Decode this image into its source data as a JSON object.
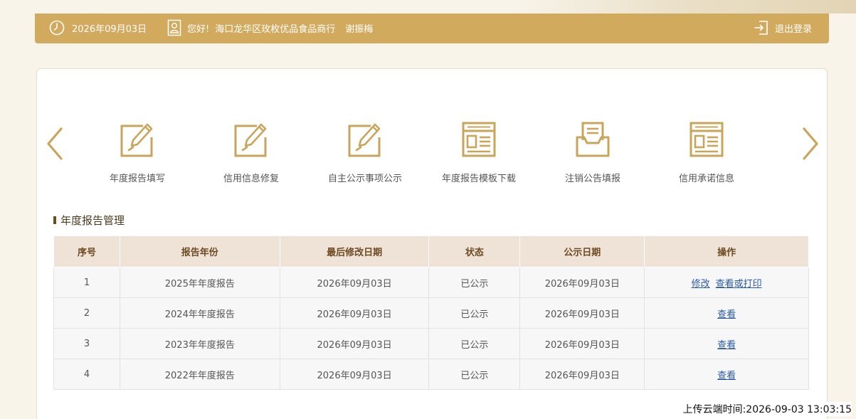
{
  "header": {
    "date": "2026年09月03日",
    "greeting": "您好!",
    "company": "海口龙华区玫枚优品食品商行",
    "person": "谢振梅",
    "logout_label": "退出登录"
  },
  "icons": {
    "clock": "clock-icon",
    "user": "user-card-icon",
    "logout": "logout-icon"
  },
  "colors": {
    "accent": "#d2aa5d",
    "icon_gold": "#c9a55a",
    "table_header_bg": "#eee3d6",
    "link": "#2a5aa8"
  },
  "menu": {
    "items": [
      {
        "label": "年度报告填写",
        "icon": "edit-icon"
      },
      {
        "label": "信用信息修复",
        "icon": "edit-icon"
      },
      {
        "label": "自主公示事项公示",
        "icon": "edit-icon"
      },
      {
        "label": "年度报告模板下载",
        "icon": "template-icon"
      },
      {
        "label": "注销公告填报",
        "icon": "inbox-icon"
      },
      {
        "label": "信用承诺信息",
        "icon": "template-icon"
      }
    ]
  },
  "section": {
    "title": "年度报告管理"
  },
  "table": {
    "headers": [
      "序号",
      "报告年份",
      "最后修改日期",
      "状态",
      "公示日期",
      "操作"
    ],
    "rows": [
      {
        "no": "1",
        "year": "2025年年度报告",
        "modified": "2026年09月03日",
        "status": "已公示",
        "publish": "2026年09月03日",
        "actions": [
          "修改",
          "查看或打印"
        ]
      },
      {
        "no": "2",
        "year": "2024年年度报告",
        "modified": "2026年09月03日",
        "status": "已公示",
        "publish": "2026年09月03日",
        "actions": [
          "查看"
        ]
      },
      {
        "no": "3",
        "year": "2023年年度报告",
        "modified": "2026年09月03日",
        "status": "已公示",
        "publish": "2026年09月03日",
        "actions": [
          "查看"
        ]
      },
      {
        "no": "4",
        "year": "2022年年度报告",
        "modified": "2026年09月03日",
        "status": "已公示",
        "publish": "2026年09月03日",
        "actions": [
          "查看"
        ]
      }
    ]
  },
  "footer": {
    "upload_time": "上传云端时间:2026-09-03 13:03:15"
  }
}
